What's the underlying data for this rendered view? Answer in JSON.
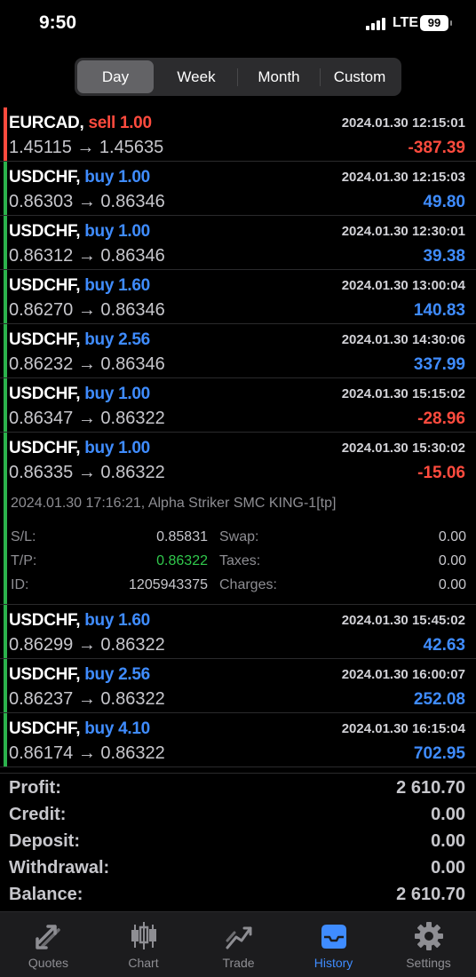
{
  "status": {
    "time": "9:50",
    "network": "LTE",
    "battery": "99"
  },
  "segments": [
    {
      "label": "Day",
      "active": true
    },
    {
      "label": "Week",
      "active": false
    },
    {
      "label": "Month",
      "active": false
    },
    {
      "label": "Custom",
      "active": false
    }
  ],
  "deals": [
    {
      "symbol": "EURCAD,",
      "side": "sell",
      "volume": "1.00",
      "prices": "1.45115 → 1.45635",
      "time": "2024.01.30 12:15:01",
      "profit": "-387.39",
      "color": "#ff4b3e"
    },
    {
      "symbol": "USDCHF,",
      "side": "buy",
      "volume": "1.00",
      "prices": "0.86303 → 0.86346",
      "time": "2024.01.30 12:15:03",
      "profit": "49.80",
      "color": "#2bb24c"
    },
    {
      "symbol": "USDCHF,",
      "side": "buy",
      "volume": "1.00",
      "prices": "0.86312 → 0.86346",
      "time": "2024.01.30 12:30:01",
      "profit": "39.38",
      "color": "#2bb24c"
    },
    {
      "symbol": "USDCHF,",
      "side": "buy",
      "volume": "1.60",
      "prices": "0.86270 → 0.86346",
      "time": "2024.01.30 13:00:04",
      "profit": "140.83",
      "color": "#2bb24c"
    },
    {
      "symbol": "USDCHF,",
      "side": "buy",
      "volume": "2.56",
      "prices": "0.86232 → 0.86346",
      "time": "2024.01.30 14:30:06",
      "profit": "337.99",
      "color": "#2bb24c"
    },
    {
      "symbol": "USDCHF,",
      "side": "buy",
      "volume": "1.00",
      "prices": "0.86347 → 0.86322",
      "time": "2024.01.30 15:15:02",
      "profit": "-28.96",
      "color": "#2bb24c"
    },
    {
      "symbol": "USDCHF,",
      "side": "buy",
      "volume": "1.00",
      "prices": "0.86335 → 0.86322",
      "time": "2024.01.30 15:30:02",
      "profit": "-15.06",
      "color": "#2bb24c"
    },
    {
      "symbol": "USDCHF,",
      "side": "buy",
      "volume": "1.60",
      "prices": "0.86299 → 0.86322",
      "time": "2024.01.30 15:45:02",
      "profit": "42.63",
      "color": "#2bb24c"
    },
    {
      "symbol": "USDCHF,",
      "side": "buy",
      "volume": "2.56",
      "prices": "0.86237 → 0.86322",
      "time": "2024.01.30 16:00:07",
      "profit": "252.08",
      "color": "#2bb24c"
    },
    {
      "symbol": "USDCHF,",
      "side": "buy",
      "volume": "4.10",
      "prices": "0.86174 → 0.86322",
      "time": "2024.01.30 16:15:04",
      "profit": "702.95",
      "color": "#2bb24c"
    }
  ],
  "detail": {
    "comment": "2024.01.30 17:16:21, Alpha Striker SMC KING-1[tp]",
    "sl_label": "S/L:",
    "sl_value": "0.85831",
    "tp_label": "T/P:",
    "tp_value": "0.86322",
    "id_label": "ID:",
    "id_value": "1205943375",
    "swap_label": "Swap:",
    "swap_value": "0.00",
    "taxes_label": "Taxes:",
    "taxes_value": "0.00",
    "charges_label": "Charges:",
    "charges_value": "0.00"
  },
  "summary": [
    {
      "label": "Profit:",
      "value": "2 610.70"
    },
    {
      "label": "Credit:",
      "value": "0.00"
    },
    {
      "label": "Deposit:",
      "value": "0.00"
    },
    {
      "label": "Withdrawal:",
      "value": "0.00"
    },
    {
      "label": "Balance:",
      "value": "2 610.70"
    }
  ],
  "tabs": [
    {
      "label": "Quotes",
      "icon": "quotes-icon",
      "active": false
    },
    {
      "label": "Chart",
      "icon": "candlestick-chart-icon",
      "active": false
    },
    {
      "label": "Trade",
      "icon": "trade-icon",
      "active": false
    },
    {
      "label": "History",
      "icon": "history-inbox-icon",
      "active": true
    },
    {
      "label": "Settings",
      "icon": "gear-icon",
      "active": false
    }
  ],
  "colors": {
    "buy": "#3f8cff",
    "sell": "#ff4b3e",
    "tab_active": "#3f8cff",
    "tp_green": "#30c84c"
  }
}
